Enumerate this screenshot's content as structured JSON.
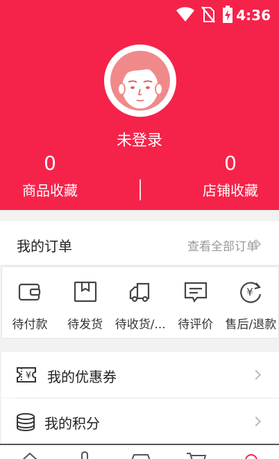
{
  "status_bar": {
    "time": "4:36",
    "icons": [
      "wifi-icon",
      "no-sim-icon",
      "battery-charging-icon"
    ]
  },
  "profile": {
    "avatar_icon": "avatar-face-icon",
    "login_text": "未登录",
    "stats": [
      {
        "count": "0",
        "label": "商品收藏"
      },
      {
        "count": "0",
        "label": "店铺收藏"
      }
    ]
  },
  "orders": {
    "title": "我的订单",
    "view_all": "查看全部订单",
    "items": [
      {
        "label": "待付款",
        "icon": "wallet-icon"
      },
      {
        "label": "待发货",
        "icon": "package-icon"
      },
      {
        "label": "待收货/...",
        "icon": "truck-icon"
      },
      {
        "label": "待评价",
        "icon": "comment-icon"
      },
      {
        "label": "售后/退款",
        "icon": "refund-icon"
      }
    ]
  },
  "menu": [
    {
      "label": "我的优惠券",
      "icon": "coupon-icon"
    },
    {
      "label": "我的积分",
      "icon": "coins-icon"
    }
  ],
  "bottom_nav": {
    "icons": [
      "home-icon",
      "category-icon",
      "store-icon",
      "cart-icon",
      "profile-icon"
    ]
  },
  "colors": {
    "brand": "#f5234a",
    "background": "#f2f2f2"
  }
}
